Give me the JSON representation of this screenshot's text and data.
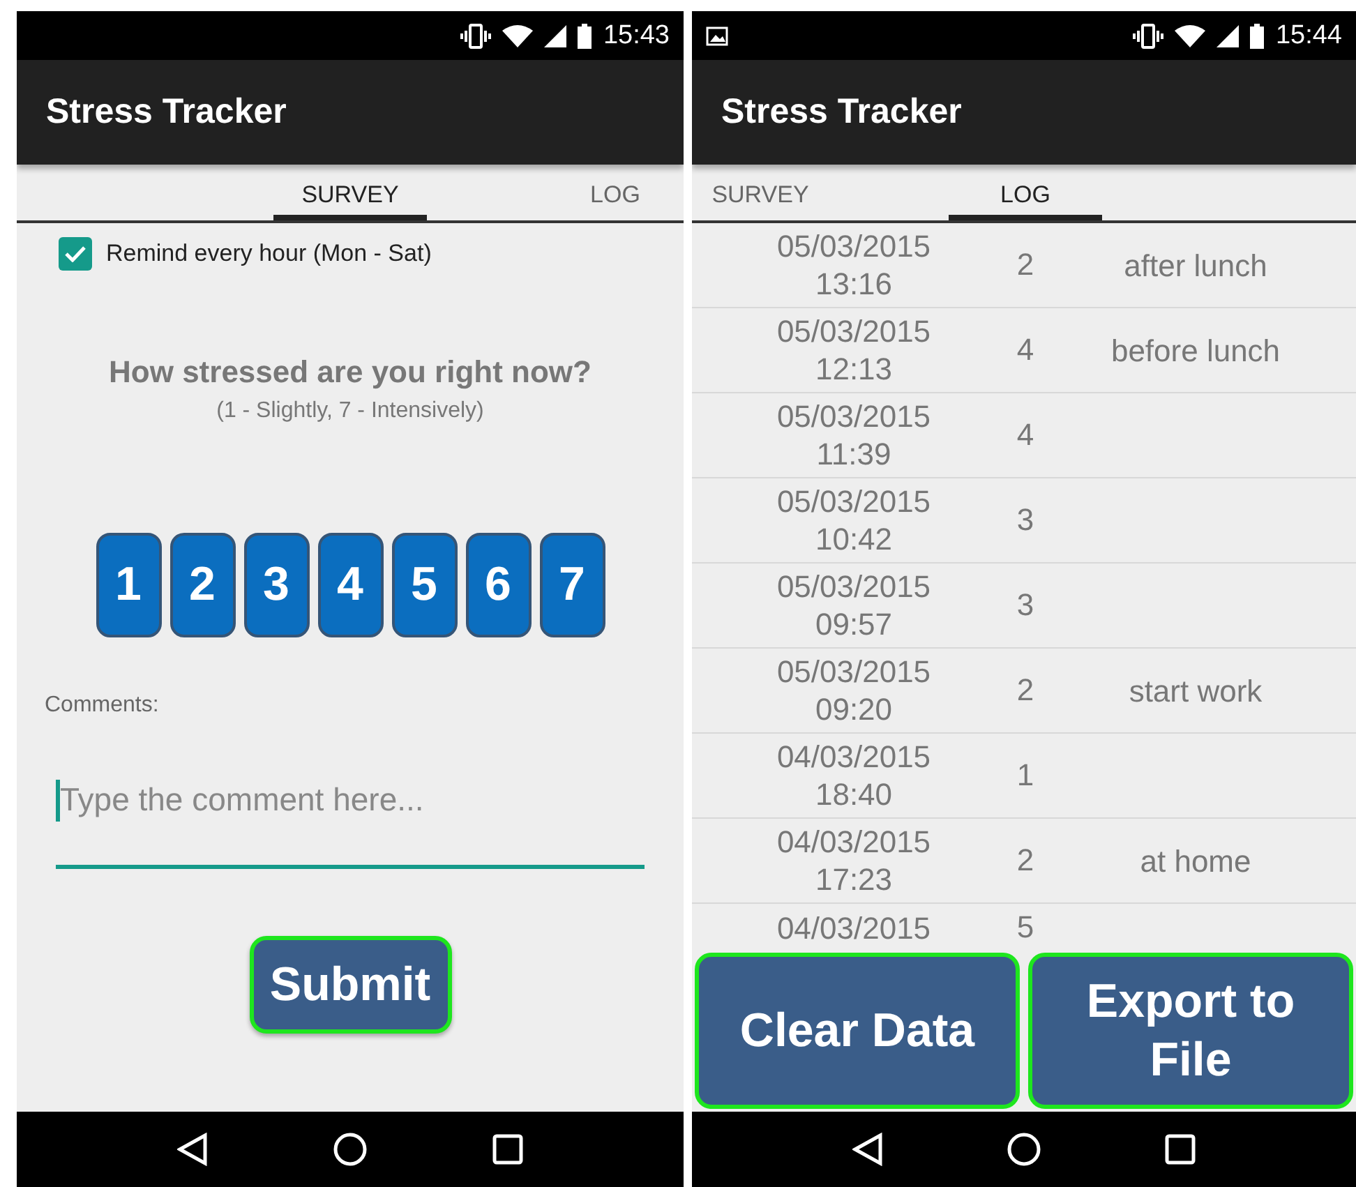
{
  "screens": [
    {
      "kind": "survey",
      "status_bar": {
        "time": "15:43",
        "notification": false
      },
      "app_title": "Stress Tracker",
      "tabs": [
        {
          "label": "SURVEY",
          "selected": true
        },
        {
          "label": "LOG",
          "selected": false
        }
      ],
      "reminder": {
        "label": "Remind every hour (Mon - Sat)",
        "checked": true
      },
      "question": "How stressed are you right now?",
      "scale_hint": "(1 - Slightly, 7 - Intensively)",
      "ratings": [
        "1",
        "2",
        "3",
        "4",
        "5",
        "6",
        "7"
      ],
      "comments_label": "Comments:",
      "comment_field": {
        "placeholder": "Type the comment here..."
      },
      "submit": "Submit"
    },
    {
      "kind": "log",
      "status_bar": {
        "time": "15:44",
        "notification": true
      },
      "app_title": "Stress Tracker",
      "tabs": [
        {
          "label": "SURVEY",
          "selected": false
        },
        {
          "label": "LOG",
          "selected": true
        }
      ],
      "rows": [
        {
          "date": "05/03/2015",
          "time": "13:16",
          "level": "2",
          "note": "after lunch"
        },
        {
          "date": "05/03/2015",
          "time": "12:13",
          "level": "4",
          "note": "before lunch"
        },
        {
          "date": "05/03/2015",
          "time": "11:39",
          "level": "4"
        },
        {
          "date": "05/03/2015",
          "time": "10:42",
          "level": "3"
        },
        {
          "date": "05/03/2015",
          "time": "09:57",
          "level": "3"
        },
        {
          "date": "05/03/2015",
          "time": "09:20",
          "level": "2",
          "note": "start work"
        },
        {
          "date": "04/03/2015",
          "time": "18:40",
          "level": "1"
        },
        {
          "date": "04/03/2015",
          "time": "17:23",
          "level": "2",
          "note": "at home"
        },
        {
          "date": "04/03/2015",
          "level": "5"
        }
      ],
      "buttons": [
        "Clear Data",
        "Export to File"
      ]
    }
  ]
}
